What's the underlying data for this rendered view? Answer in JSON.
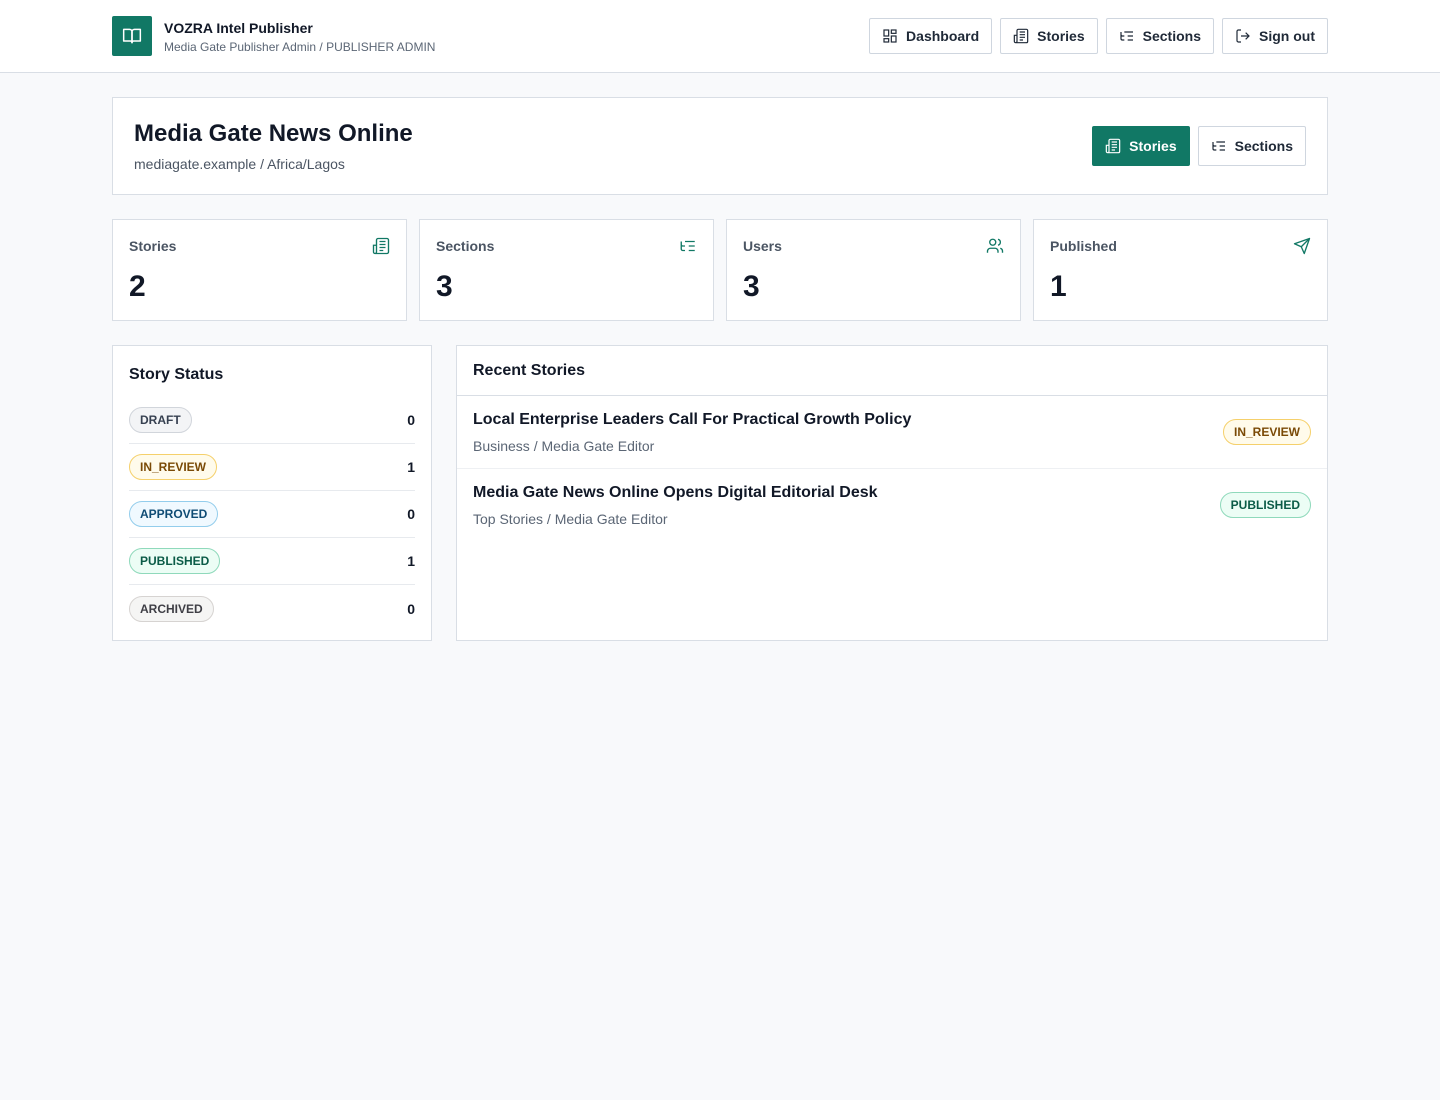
{
  "app": {
    "title": "VOZRA Intel Publisher",
    "subtitle": "Media Gate Publisher Admin / PUBLISHER ADMIN"
  },
  "nav": {
    "dashboard": "Dashboard",
    "stories": "Stories",
    "sections": "Sections",
    "signout": "Sign out"
  },
  "publication": {
    "name": "Media Gate News Online",
    "meta": "mediagate.example / Africa/Lagos",
    "stories_button": "Stories",
    "sections_button": "Sections"
  },
  "stats": [
    {
      "label": "Stories",
      "value": "2",
      "icon": "newspaper-icon"
    },
    {
      "label": "Sections",
      "value": "3",
      "icon": "list-tree-icon"
    },
    {
      "label": "Users",
      "value": "3",
      "icon": "users-icon"
    },
    {
      "label": "Published",
      "value": "1",
      "icon": "send-icon"
    }
  ],
  "story_status": {
    "title": "Story Status",
    "items": [
      {
        "label": "DRAFT",
        "count": "0"
      },
      {
        "label": "IN_REVIEW",
        "count": "1"
      },
      {
        "label": "APPROVED",
        "count": "0"
      },
      {
        "label": "PUBLISHED",
        "count": "1"
      },
      {
        "label": "ARCHIVED",
        "count": "0"
      }
    ]
  },
  "recent": {
    "title": "Recent Stories",
    "stories": [
      {
        "title": "Local Enterprise Leaders Call For Practical Growth Policy",
        "meta": "Business / Media Gate Editor",
        "status": "IN_REVIEW"
      },
      {
        "title": "Media Gate News Online Opens Digital Editorial Desk",
        "meta": "Top Stories / Media Gate Editor",
        "status": "PUBLISHED"
      }
    ]
  },
  "colors": {
    "brand": "#117865",
    "draft": "#f3f4f6",
    "in_review": "#fffbeb",
    "approved": "#f0f9ff",
    "published": "#ecfdf5",
    "archived": "#f5f5f4"
  }
}
